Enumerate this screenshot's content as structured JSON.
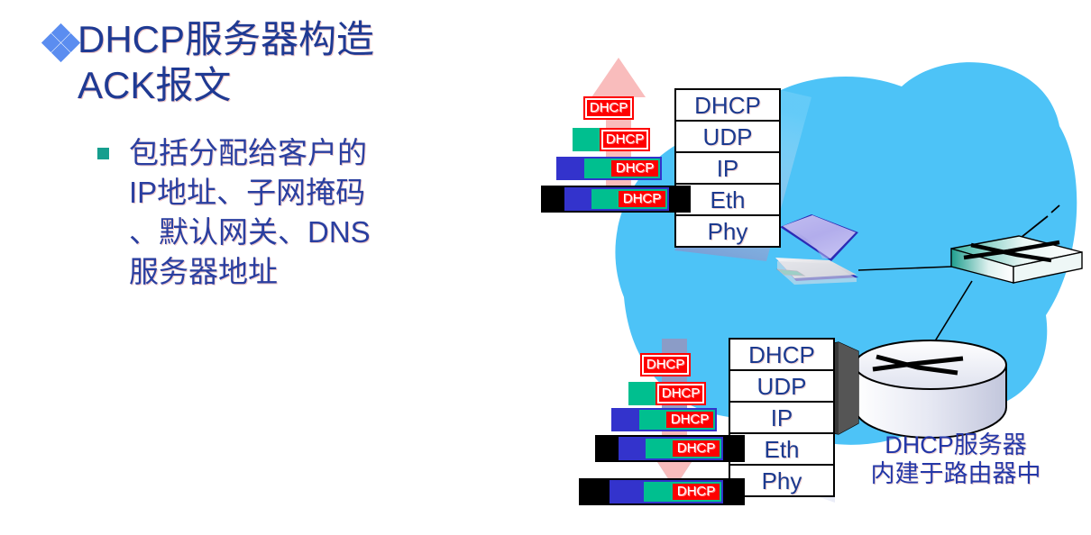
{
  "slide": {
    "heading": {
      "bullet_icon": "diamond-cluster-bullet",
      "text": "DHCP服务器构造\nACK报文"
    },
    "subbullet": {
      "bullet_icon": "square-bullet",
      "text": "包括分配给客户的\nIP地址、子网掩码\n、默认网关、DNS\n服务器地址"
    }
  },
  "diagram": {
    "protocol_stack_top": {
      "name": "client-protocol-stack",
      "layers": [
        "DHCP",
        "UDP",
        "IP",
        "Eth",
        "Phy"
      ]
    },
    "protocol_stack_bottom": {
      "name": "server-protocol-stack",
      "layers": [
        "DHCP",
        "UDP",
        "IP",
        "Eth",
        "Phy"
      ]
    },
    "packets_top": [
      {
        "label": "DHCP",
        "headers": []
      },
      {
        "label": "DHCP",
        "headers": [
          "udp"
        ]
      },
      {
        "label": "DHCP",
        "headers": [
          "ip",
          "udp"
        ]
      },
      {
        "label": "DHCP",
        "headers": [
          "phy",
          "ip",
          "udp"
        ]
      }
    ],
    "packets_bottom": [
      {
        "label": "DHCP",
        "headers": []
      },
      {
        "label": "DHCP",
        "headers": [
          "udp"
        ]
      },
      {
        "label": "DHCP",
        "headers": [
          "ip",
          "udp"
        ]
      },
      {
        "label": "DHCP",
        "headers": [
          "phy",
          "ip",
          "udp"
        ]
      },
      {
        "label": "DHCP",
        "headers": [
          "phy",
          "ip",
          "udp"
        ]
      }
    ],
    "arrow_top": {
      "name": "upward-encapsulation-arrow",
      "direction": "up",
      "color": "#f9bcbc"
    },
    "arrow_bottom": {
      "name": "downward-encapsulation-arrow",
      "direction": "down",
      "color": "#f9bcbc"
    },
    "devices": {
      "laptop": "client-laptop",
      "switch": "ethernet-switch",
      "server": "dhcp-server-router"
    },
    "server_caption": "DHCP服务器\n内建于路由器中",
    "cloud_color": "#4dc3f7"
  }
}
